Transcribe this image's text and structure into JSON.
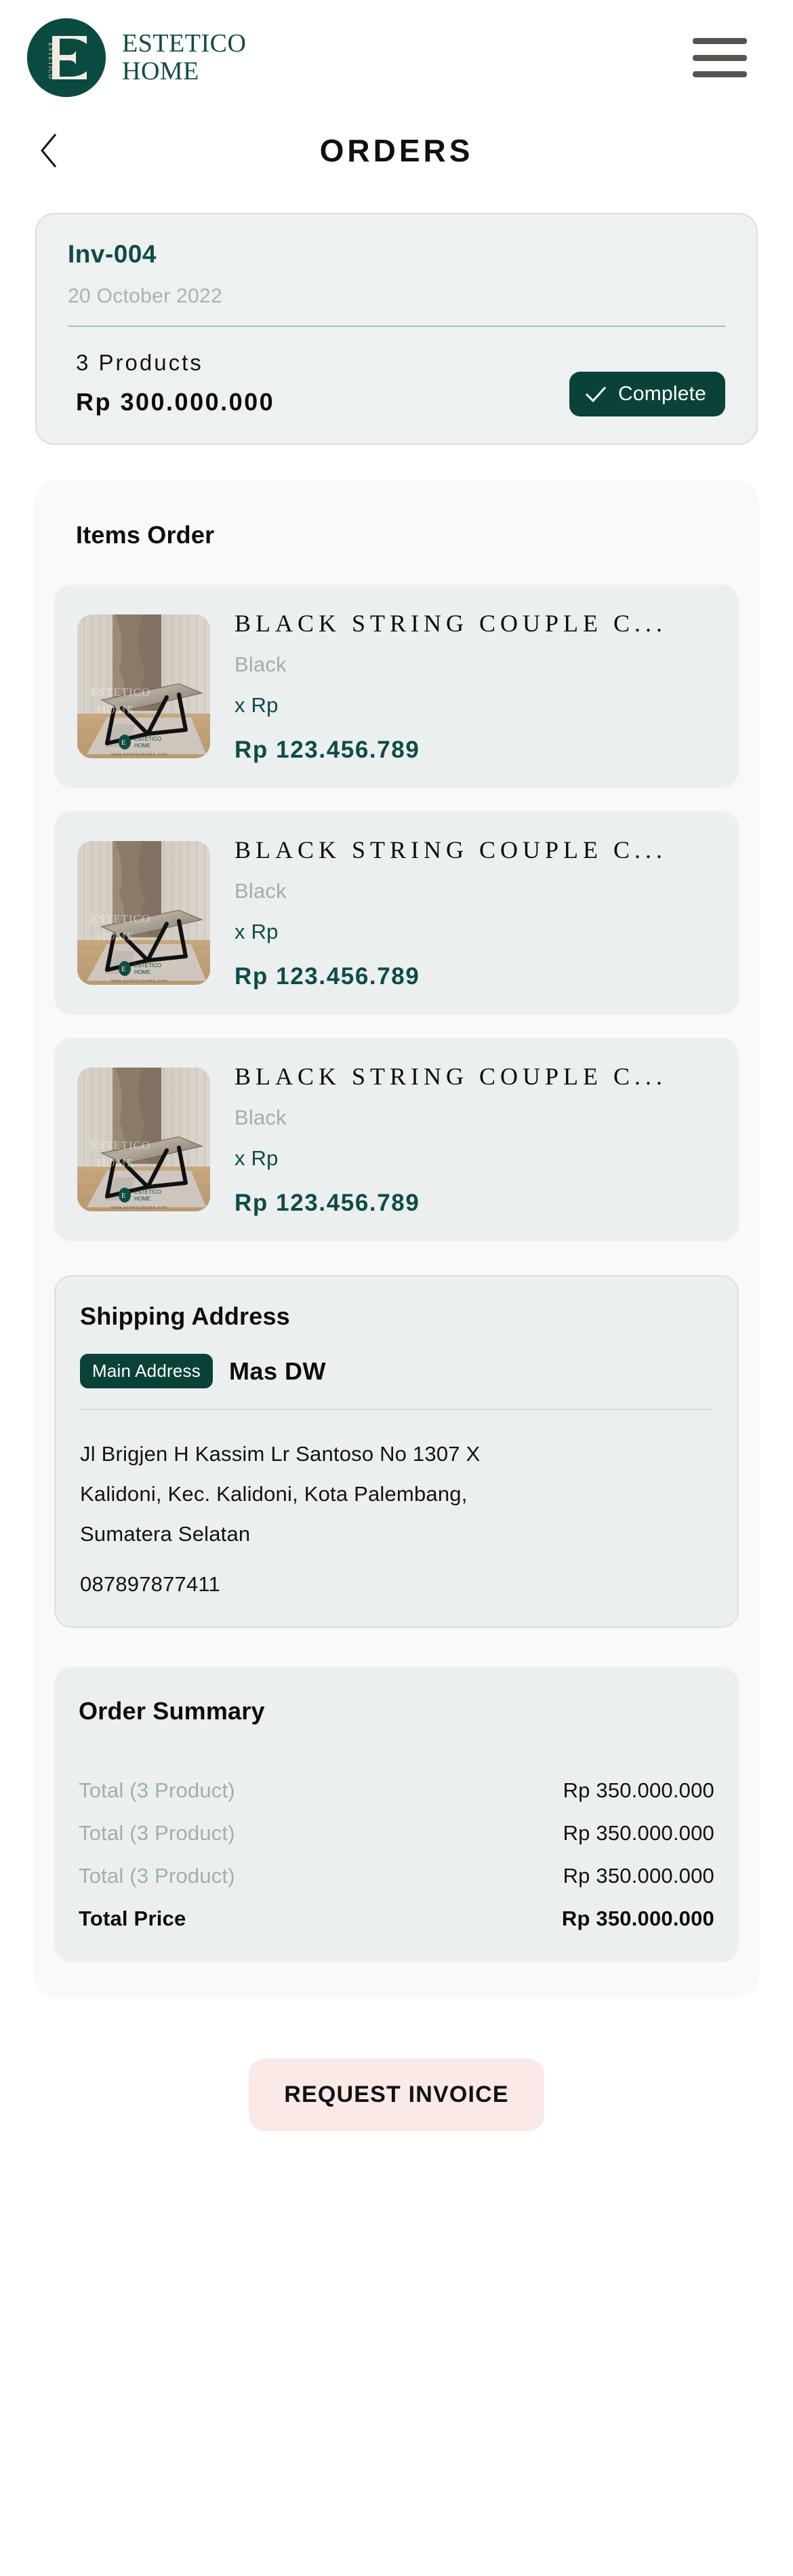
{
  "header": {
    "logo_icon": "estetico-e-monogram",
    "brand_line1": "ESTETICO",
    "brand_line2": "HOME",
    "menu_icon": "hamburger-menu-icon"
  },
  "nav": {
    "back_icon": "chevron-left-icon",
    "title": "ORDERS"
  },
  "invoice": {
    "id": "Inv-004",
    "date": "20 October 2022",
    "product_count_label": "3 Products",
    "total": "Rp 300.000.000",
    "status_label": "Complete",
    "status_icon": "check-icon",
    "status_color": "#0a4239"
  },
  "items_section": {
    "title": "Items Order",
    "items": [
      {
        "image_icon": "marble-coffee-table-photo",
        "name": "BLACK STRING COUPLE C...",
        "variant": "Black",
        "qty": "x Rp",
        "price": "Rp 123.456.789"
      },
      {
        "image_icon": "marble-coffee-table-photo",
        "name": "BLACK STRING COUPLE C...",
        "variant": "Black",
        "qty": "x Rp",
        "price": "Rp 123.456.789"
      },
      {
        "image_icon": "marble-coffee-table-photo",
        "name": "BLACK STRING COUPLE C...",
        "variant": "Black",
        "qty": "x Rp",
        "price": "Rp 123.456.789"
      }
    ]
  },
  "shipping": {
    "title": "Shipping Address",
    "badge": "Main Address",
    "recipient": "Mas DW",
    "address_line1": "Jl Brigjen H Kassim Lr Santoso No 1307 X",
    "address_line2": "Kalidoni, Kec. Kalidoni, Kota Palembang,",
    "address_line3": "Sumatera Selatan",
    "phone": "087897877411"
  },
  "summary": {
    "title": "Order Summary",
    "rows": [
      {
        "label": "Total (3 Product)",
        "value": "Rp 350.000.000"
      },
      {
        "label": "Total (3 Product)",
        "value": "Rp 350.000.000"
      },
      {
        "label": "Total (3 Product)",
        "value": "Rp 350.000.000"
      }
    ],
    "total_label": "Total Price",
    "total_value": "Rp 350.000.000"
  },
  "footer": {
    "request_invoice_label": "REQUEST INVOICE",
    "request_invoice_bg": "#fae9e7"
  }
}
